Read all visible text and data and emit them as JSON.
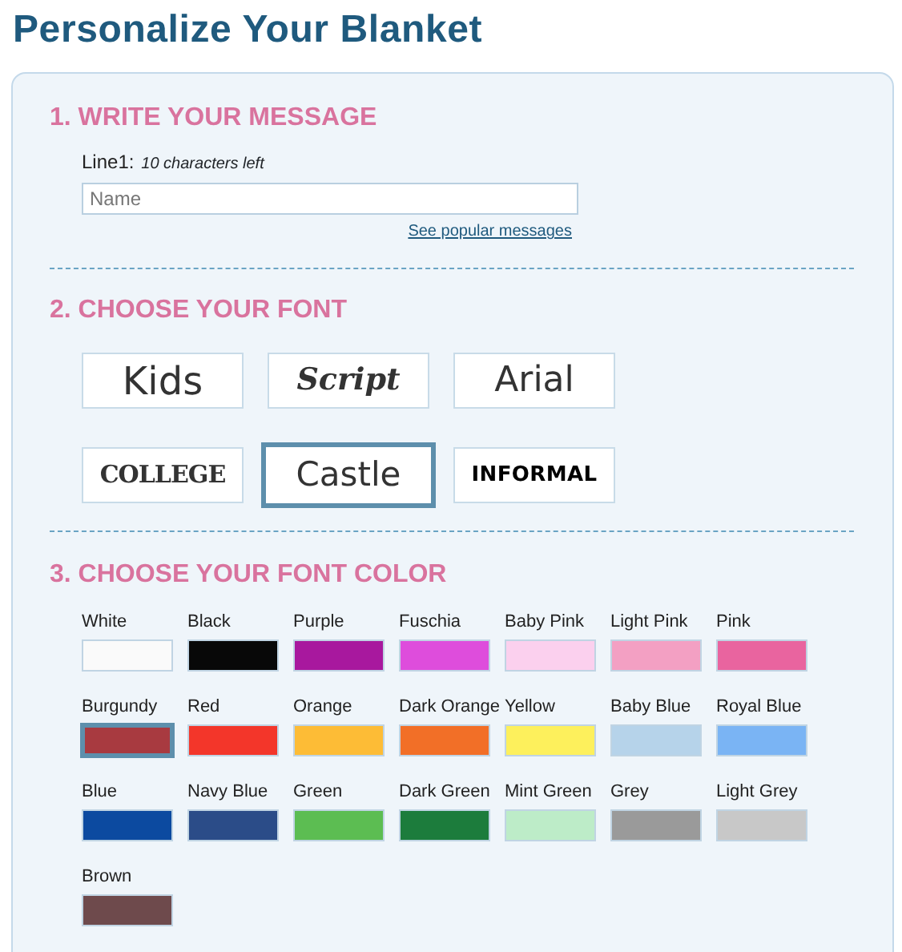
{
  "title": "Personalize Your Blanket",
  "message": {
    "heading": "1. WRITE YOUR MESSAGE",
    "label": "Line1:",
    "hint": "10 characters left",
    "placeholder": "Name",
    "link": "See popular messages"
  },
  "fonts": {
    "heading": "2. CHOOSE YOUR FONT",
    "items": [
      {
        "label": "Kids",
        "kind": "kids",
        "selected": false
      },
      {
        "label": "Script",
        "kind": "script",
        "selected": false
      },
      {
        "label": "Arial",
        "kind": "arial",
        "selected": false
      },
      {
        "label": "COLLEGE",
        "kind": "college",
        "selected": false
      },
      {
        "label": "Castle",
        "kind": "castle",
        "selected": true
      },
      {
        "label": "INFORMAL",
        "kind": "informal",
        "selected": false
      }
    ]
  },
  "colors": {
    "heading": "3. CHOOSE YOUR FONT COLOR",
    "items": [
      {
        "label": "White",
        "color": "#fafafa",
        "selected": false
      },
      {
        "label": "Black",
        "color": "#080808",
        "selected": false
      },
      {
        "label": "Purple",
        "color": "#a8189e",
        "selected": false
      },
      {
        "label": "Fuschia",
        "color": "#de4ddc",
        "selected": false
      },
      {
        "label": "Baby Pink",
        "color": "#fbd0ee",
        "selected": false
      },
      {
        "label": "Light Pink",
        "color": "#f3a0c3",
        "selected": false
      },
      {
        "label": "Pink",
        "color": "#e9649f",
        "selected": false
      },
      {
        "label": "Burgundy",
        "color": "#a83a40",
        "selected": true
      },
      {
        "label": "Red",
        "color": "#f3362a",
        "selected": false
      },
      {
        "label": "Orange",
        "color": "#fdbc36",
        "selected": false
      },
      {
        "label": "Dark Orange",
        "color": "#f26f27",
        "selected": false
      },
      {
        "label": "Yellow",
        "color": "#fdf05c",
        "selected": false
      },
      {
        "label": "Baby Blue",
        "color": "#b6d3ea",
        "selected": false
      },
      {
        "label": "Royal Blue",
        "color": "#7ab4f4",
        "selected": false
      },
      {
        "label": "Blue",
        "color": "#0c4aa0",
        "selected": false
      },
      {
        "label": "Navy Blue",
        "color": "#2b4c88",
        "selected": false
      },
      {
        "label": "Green",
        "color": "#5cbd52",
        "selected": false
      },
      {
        "label": "Dark Green",
        "color": "#1c7c3c",
        "selected": false
      },
      {
        "label": "Mint Green",
        "color": "#bdecc8",
        "selected": false
      },
      {
        "label": "Grey",
        "color": "#9a9a9a",
        "selected": false
      },
      {
        "label": "Light Grey",
        "color": "#c8c8c8",
        "selected": false
      },
      {
        "label": "Brown",
        "color": "#6e4a4c",
        "selected": false
      }
    ]
  }
}
